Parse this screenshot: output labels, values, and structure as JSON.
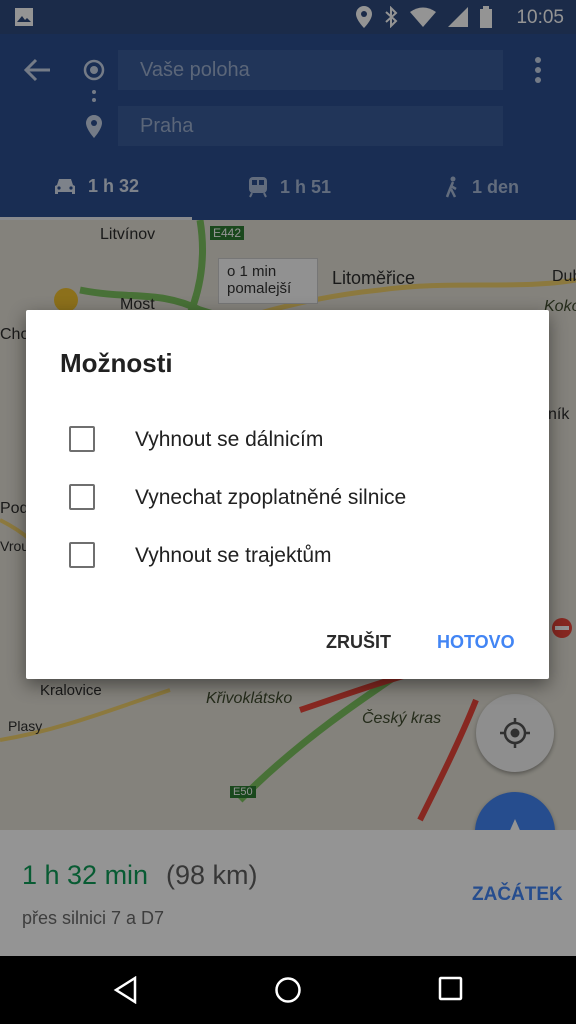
{
  "status_bar": {
    "time": "10:05",
    "icons": [
      "image-icon",
      "location-icon",
      "bluetooth-icon",
      "wifi-icon",
      "signal-icon",
      "battery-icon"
    ]
  },
  "header": {
    "origin_placeholder": "Vaše poloha",
    "destination": "Praha",
    "modes": [
      {
        "name": "car",
        "time": "1 h 32"
      },
      {
        "name": "transit",
        "time": "1 h 51"
      },
      {
        "name": "walk",
        "time": "1 den"
      }
    ]
  },
  "map": {
    "labels": {
      "litvinov": "Litvínov",
      "e442": "E442",
      "most": "Most",
      "cho": "Cho",
      "delay_line1": "o 1 min",
      "delay_line2": "pomalejší",
      "litomerice": "Litoměřice",
      "dub": "Dub",
      "kokorin": "Kokořín",
      "nik": "ník",
      "pod": "Pod",
      "vrou": "Vrou",
      "kralovice": "Kralovice",
      "krivoklatsko": "Křivoklátsko",
      "plasy": "Plasy",
      "cesky_kras": "Český kras",
      "e50": "E50"
    },
    "road_color_main": "#7cc35f",
    "traffic_color": "#e8463a"
  },
  "route": {
    "duration": "1 h 32 min",
    "distance": "(98 km)",
    "via": "přes silnici 7 a D7",
    "start_label": "ZAČÁTEK"
  },
  "dialog": {
    "title": "Možnosti",
    "options": [
      {
        "label": "Vyhnout se dálnicím",
        "checked": false
      },
      {
        "label": "Vynechat zpoplatněné silnice",
        "checked": false
      },
      {
        "label": "Vyhnout se trajektům",
        "checked": false
      }
    ],
    "cancel_label": "ZRUŠIT",
    "done_label": "HOTOVO"
  },
  "colors": {
    "accent": "#4285f4",
    "header": "#2b4f8f",
    "duration_green": "#0f9d58"
  }
}
